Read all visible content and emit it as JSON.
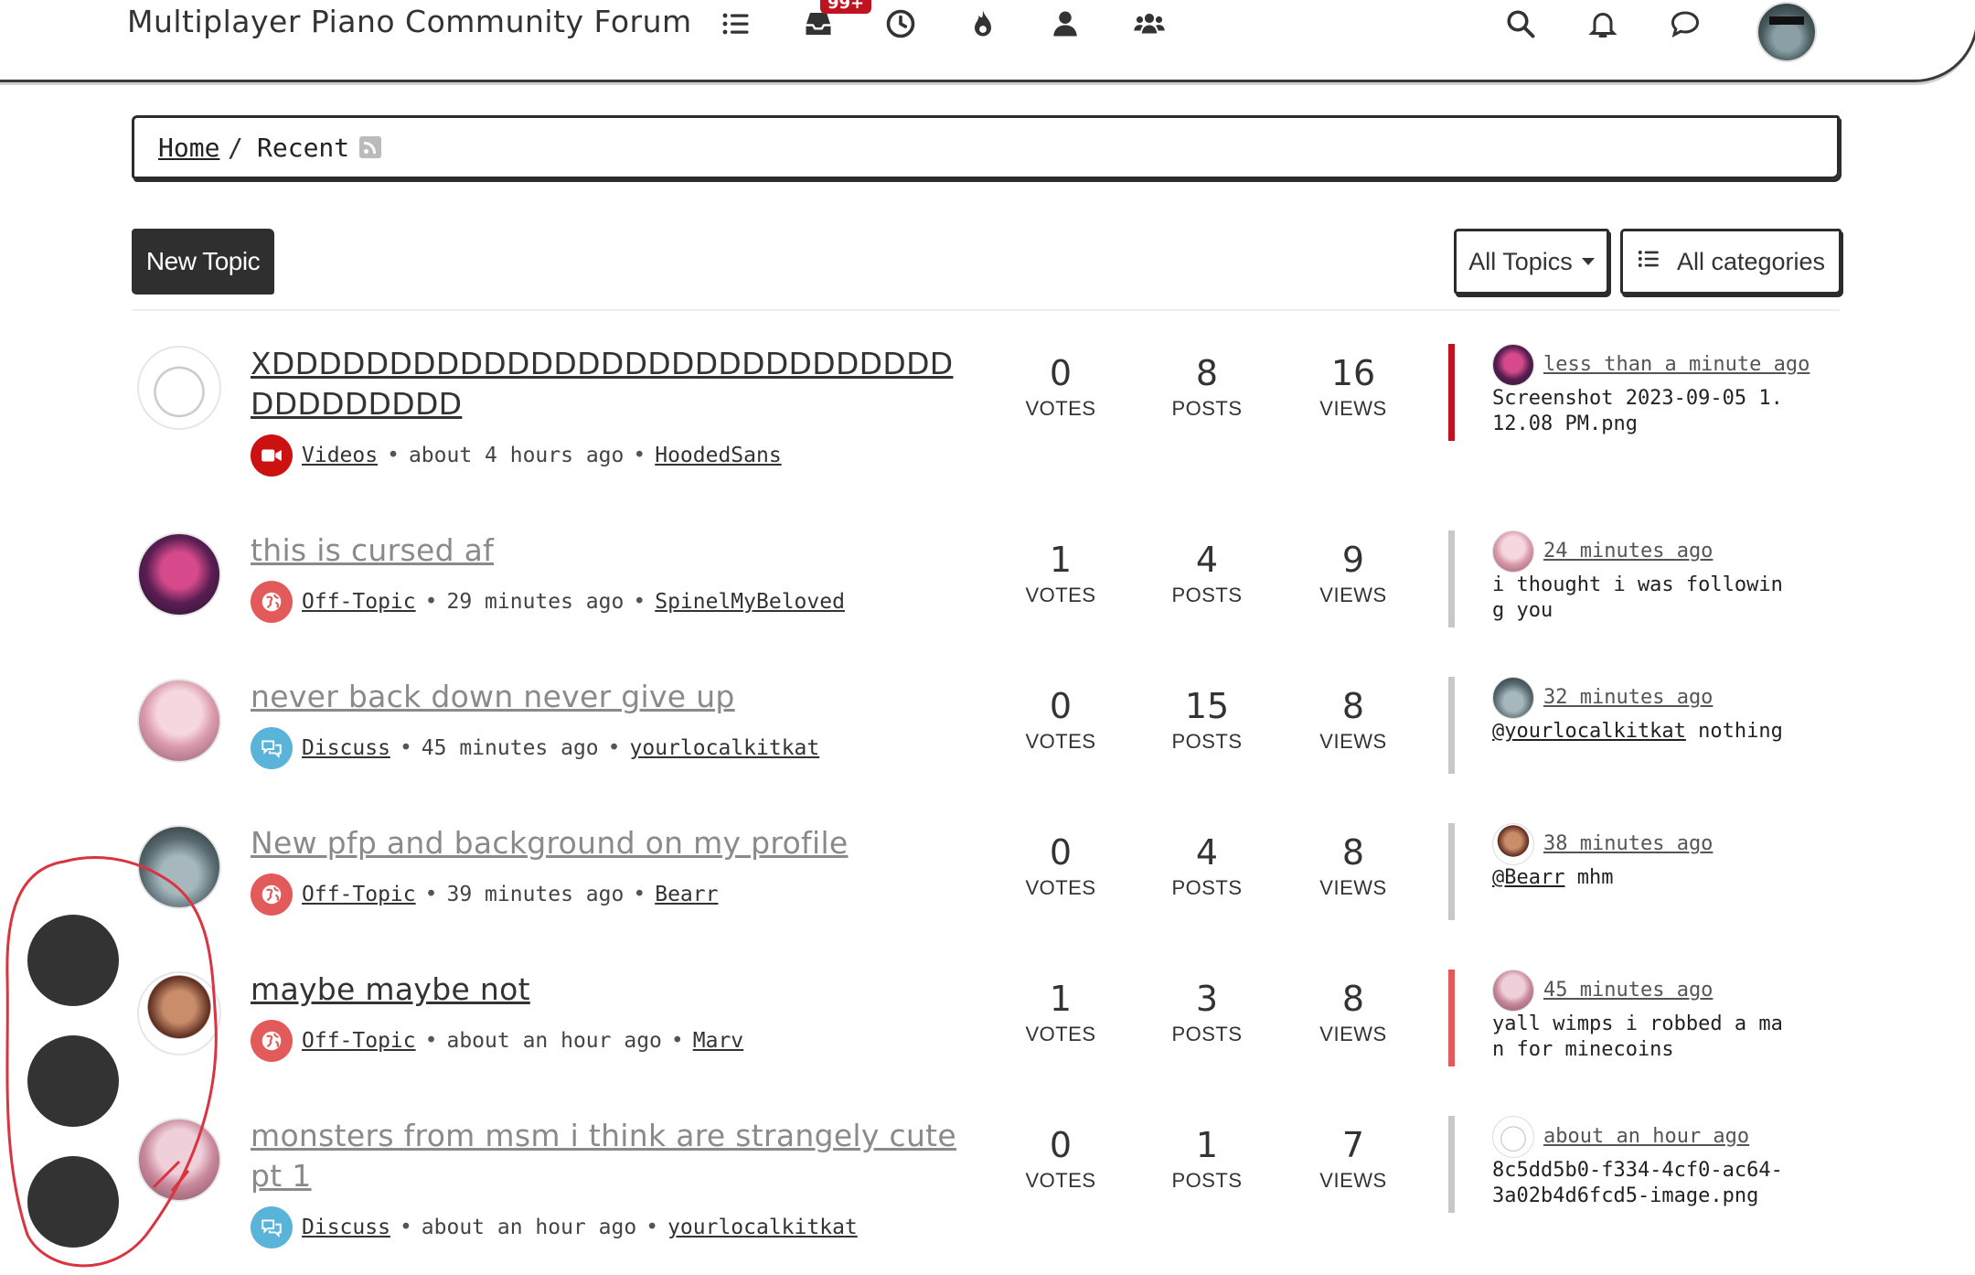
{
  "header": {
    "brand": "Multiplayer Piano Community Forum",
    "unread_badge": "99+",
    "nav_icons": [
      "categories-icon",
      "unread-icon",
      "recent-icon",
      "popular-icon",
      "user-icon",
      "groups-icon"
    ],
    "right_icons": [
      "search-icon",
      "notifications-icon",
      "chat-icon"
    ]
  },
  "breadcrumb": {
    "home": "Home",
    "separator": "/",
    "current": "Recent"
  },
  "toolbar": {
    "new_topic": "New Topic",
    "filter": "All Topics",
    "categories": "All categories"
  },
  "topics": [
    {
      "title": "XDDDDDDDDDDDDDDDDDDDDDDDDDDDDDDDDDDDDDD",
      "unread": true,
      "category": "Videos",
      "category_color": "#cc1111",
      "category_icon": "video-icon",
      "time": "about 4 hours ago",
      "author": "HoodedSans",
      "votes": "0",
      "posts": "8",
      "views": "16",
      "votes_label": "VOTES",
      "posts_label": "POSTS",
      "views_label": "VIEWS",
      "teaser_color": "#c1121f",
      "teaser_time": "less than a minute ago",
      "teaser_mention": "",
      "teaser_text": "Screenshot 2023-09-05 1.12.08 PM.png"
    },
    {
      "title": "this is cursed af",
      "unread": false,
      "category": "Off-Topic",
      "category_color": "#e35a5a",
      "category_icon": "globe-icon",
      "time": "29 minutes ago",
      "author": "SpinelMyBeloved",
      "votes": "1",
      "posts": "4",
      "views": "9",
      "votes_label": "VOTES",
      "posts_label": "POSTS",
      "views_label": "VIEWS",
      "teaser_color": "#c8c8c8",
      "teaser_time": "24 minutes ago",
      "teaser_mention": "",
      "teaser_text": "i thought i was following you"
    },
    {
      "title": "never back down never give up",
      "unread": false,
      "category": "Discuss",
      "category_color": "#5ab4d9",
      "category_icon": "comments-icon",
      "time": "45 minutes ago",
      "author": "yourlocalkitkat",
      "votes": "0",
      "posts": "15",
      "views": "8",
      "votes_label": "VOTES",
      "posts_label": "POSTS",
      "views_label": "VIEWS",
      "teaser_color": "#c8c8c8",
      "teaser_time": "32 minutes ago",
      "teaser_mention": "@yourlocalkitkat",
      "teaser_text": " nothing"
    },
    {
      "title": "New pfp and background on my profile",
      "unread": false,
      "category": "Off-Topic",
      "category_color": "#e35a5a",
      "category_icon": "globe-icon",
      "time": "39 minutes ago",
      "author": "Bearr",
      "votes": "0",
      "posts": "4",
      "views": "8",
      "votes_label": "VOTES",
      "posts_label": "POSTS",
      "views_label": "VIEWS",
      "teaser_color": "#c8c8c8",
      "teaser_time": "38 minutes ago",
      "teaser_mention": "@Bearr",
      "teaser_text": " mhm"
    },
    {
      "title": "maybe maybe not",
      "unread": true,
      "category": "Off-Topic",
      "category_color": "#e35a5a",
      "category_icon": "globe-icon",
      "time": "about an hour ago",
      "author": "Marv",
      "votes": "1",
      "posts": "3",
      "views": "8",
      "votes_label": "VOTES",
      "posts_label": "POSTS",
      "views_label": "VIEWS",
      "teaser_color": "#e35a5a",
      "teaser_time": "45 minutes ago",
      "teaser_mention": "",
      "teaser_text": "yall wimps i robbed a man for minecoins"
    },
    {
      "title": "monsters from msm i think are strangely cute pt 1",
      "unread": false,
      "category": "Discuss",
      "category_color": "#5ab4d9",
      "category_icon": "comments-icon",
      "time": "about an hour ago",
      "author": "yourlocalkitkat",
      "votes": "0",
      "posts": "1",
      "views": "7",
      "votes_label": "VOTES",
      "posts_label": "POSTS",
      "views_label": "VIEWS",
      "teaser_color": "#c8c8c8",
      "teaser_time": "about an hour ago",
      "teaser_mention": "",
      "teaser_text": "8c5dd5b0-f334-4cf0-ac64-3a02b4d6fcd5-image.png"
    }
  ],
  "colors": {
    "accent_dark": "#2f2f2f",
    "unread_red": "#c1121f",
    "annotation_red": "#d9343f"
  }
}
